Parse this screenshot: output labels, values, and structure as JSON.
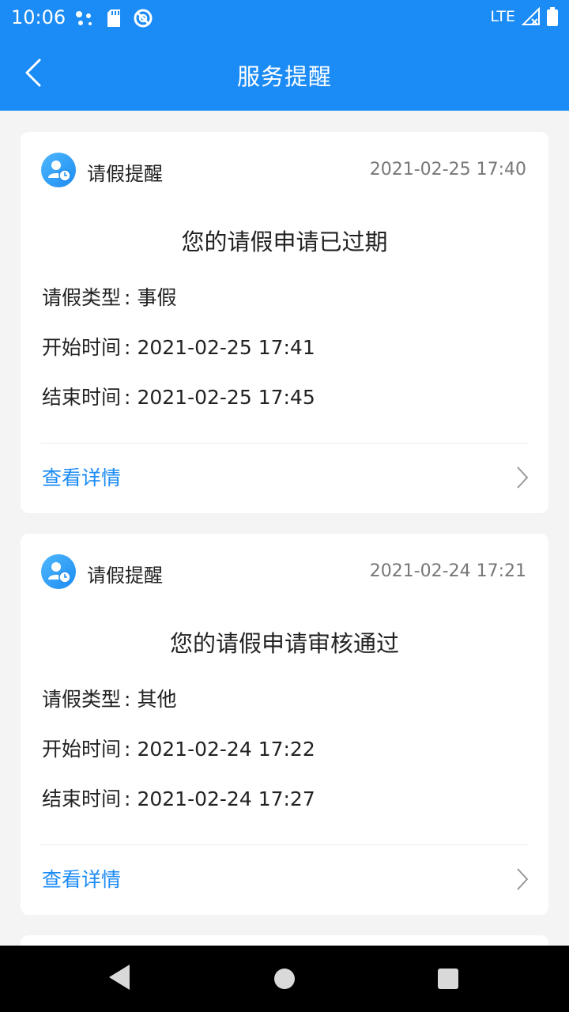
{
  "status_bar": {
    "time": "10:06",
    "network": "LTE",
    "icons": [
      "assistant-dots-icon",
      "sd-card-icon",
      "no-disturb-icon",
      "signal-icon",
      "battery-icon"
    ]
  },
  "app_bar": {
    "title": "服务提醒",
    "back_icon": "chevron-left-icon"
  },
  "cards": [
    {
      "type": "请假提醒",
      "timestamp": "2021-02-25 17:40",
      "message": "您的请假申请已过期",
      "rows": [
        {
          "label": "请假类型",
          "value": "事假"
        },
        {
          "label": "开始时间",
          "value": "2021-02-25 17:41"
        },
        {
          "label": "结束时间",
          "value": "2021-02-25 17:45"
        }
      ],
      "link": "查看详情"
    },
    {
      "type": "请假提醒",
      "timestamp": "2021-02-24 17:21",
      "message": "您的请假申请审核通过",
      "rows": [
        {
          "label": "请假类型",
          "value": "其他"
        },
        {
          "label": "开始时间",
          "value": "2021-02-24 17:22"
        },
        {
          "label": "结束时间",
          "value": "2021-02-24 17:27"
        }
      ],
      "link": "查看详情"
    }
  ],
  "colors": {
    "accent": "#1b8bf5",
    "background": "#f4f4f4",
    "card": "#ffffff"
  },
  "nav_bar": {
    "icons": [
      "back-triangle-icon",
      "home-circle-icon",
      "recents-square-icon"
    ]
  }
}
